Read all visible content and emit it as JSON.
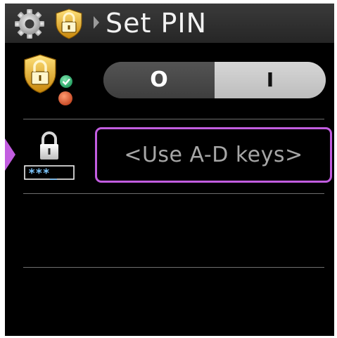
{
  "header": {
    "title": "Set PIN",
    "icons": [
      "gear-icon",
      "lock-shield-icon",
      "breadcrumb-arrow-icon"
    ]
  },
  "pin_lock_row": {
    "icon": "shield-lock-status-icon",
    "toggle": {
      "off_label": "O",
      "on_label": "I",
      "selected": "on"
    }
  },
  "pin_entry_row": {
    "icon": "lock-pin-icon",
    "mask": "***_",
    "placeholder": "<Use A-D keys>"
  },
  "colors": {
    "accent": "#c25de0",
    "shield_gold": "#e8b51f",
    "status_ok": "#2bb673",
    "status_alert": "#e0603a",
    "pin_blue": "#7fc8ff"
  }
}
